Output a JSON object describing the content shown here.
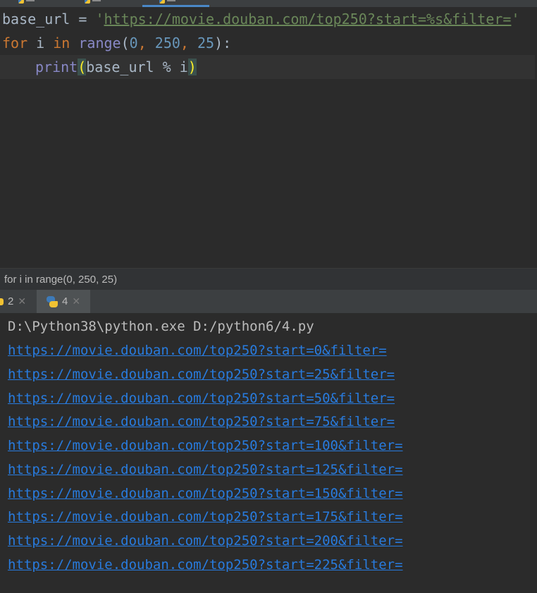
{
  "colors": {
    "editor_bg": "#2b2b2b",
    "keyword": "#cc7832",
    "string": "#6a8759",
    "number": "#6897bb",
    "builtin": "#8888c6",
    "link": "#287bde",
    "tab_underline": "#4a88c7"
  },
  "editor": {
    "line1": {
      "var": "base_url",
      "op": " = ",
      "quote_open": "'",
      "url": "https://movie.douban.com/top250?start=%s&filter=",
      "quote_close": "'"
    },
    "line2": {
      "kw_for": "for",
      "var_i": " i ",
      "kw_in": "in",
      "func": " range",
      "paren_open": "(",
      "n1": "0",
      "sep1": ", ",
      "n2": "250",
      "sep2": ", ",
      "n3": "25",
      "paren_close": "):"
    },
    "line3": {
      "func": "print",
      "paren_open": "(",
      "args": "base_url % i",
      "paren_close": ")"
    }
  },
  "breadcrumb": {
    "text": "for i in range(0, 250, 25)"
  },
  "run_tabs": [
    {
      "label": "2",
      "icon": "python-icon"
    },
    {
      "label": "4",
      "icon": "python-icon"
    }
  ],
  "console": {
    "command": "D:\\Python38\\python.exe D:/python6/4.py",
    "links": [
      "https://movie.douban.com/top250?start=0&filter=",
      "https://movie.douban.com/top250?start=25&filter=",
      "https://movie.douban.com/top250?start=50&filter=",
      "https://movie.douban.com/top250?start=75&filter=",
      "https://movie.douban.com/top250?start=100&filter=",
      "https://movie.douban.com/top250?start=125&filter=",
      "https://movie.douban.com/top250?start=150&filter=",
      "https://movie.douban.com/top250?start=175&filter=",
      "https://movie.douban.com/top250?start=200&filter=",
      "https://movie.douban.com/top250?start=225&filter="
    ]
  }
}
